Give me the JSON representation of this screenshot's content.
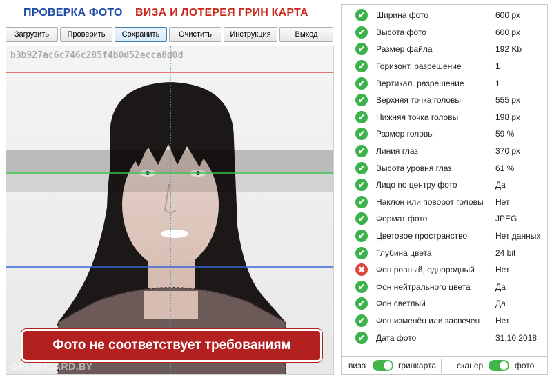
{
  "header": {
    "title_left": "ПРОВЕРКА ФОТО",
    "title_right": "ВИЗА И ЛОТЕРЕЯ ГРИН КАРТА"
  },
  "toolbar": {
    "load": "Загрузить",
    "check": "Проверить",
    "save": "Сохранить",
    "clear": "Очистить",
    "instructions": "Инструкция",
    "exit": "Выход"
  },
  "photo": {
    "hash": "b3b927ac6c746c285f4b0d52ecca8d0d",
    "result_banner": "Фото не соответствует требованиям",
    "watermark": "GREENCARD.BY"
  },
  "checks": [
    {
      "label": "Ширина фото",
      "value": "600 px",
      "status": "ok"
    },
    {
      "label": "Высота фото",
      "value": "600 px",
      "status": "ok"
    },
    {
      "label": "Размер файла",
      "value": "192 Kb",
      "status": "ok"
    },
    {
      "label": "Горизонт. разрешение",
      "value": "1",
      "status": "ok"
    },
    {
      "label": "Вертикал. разрешение",
      "value": "1",
      "status": "ok"
    },
    {
      "label": "Верхняя точка головы",
      "value": "555 px",
      "status": "ok"
    },
    {
      "label": "Нижняя точка головы",
      "value": "198 px",
      "status": "ok"
    },
    {
      "label": "Размер головы",
      "value": "59 %",
      "status": "ok"
    },
    {
      "label": "Линия глаз",
      "value": "370 px",
      "status": "ok"
    },
    {
      "label": "Высота уровня глаз",
      "value": "61 %",
      "status": "ok"
    },
    {
      "label": "Лицо по центру фото",
      "value": "Да",
      "status": "ok"
    },
    {
      "label": "Наклон или поворот головы",
      "value": "Нет",
      "status": "ok"
    },
    {
      "label": "Формат фото",
      "value": "JPEG",
      "status": "ok"
    },
    {
      "label": "Цветовое пространство",
      "value": "Нет данных",
      "status": "ok"
    },
    {
      "label": "Глубина цвета",
      "value": "24 bit",
      "status": "ok"
    },
    {
      "label": "Фон ровный, однородный",
      "value": "Нет",
      "status": "fail"
    },
    {
      "label": "Фон нейтрального цвета",
      "value": "Да",
      "status": "ok"
    },
    {
      "label": "Фон светлый",
      "value": "Да",
      "status": "ok"
    },
    {
      "label": "Фон изменён или засвечен",
      "value": "Нет",
      "status": "ok"
    },
    {
      "label": "Дата фото",
      "value": "31.10.2018",
      "status": "ok"
    }
  ],
  "toggles": {
    "left_off": "виза",
    "left_on": "гринкарта",
    "right_off": "сканер",
    "right_on": "фото"
  },
  "colors": {
    "ok": "#3bb34a",
    "fail": "#e0473f",
    "title_blue": "#1f4aa8",
    "title_red": "#c9291d",
    "banner": "#b32020"
  }
}
